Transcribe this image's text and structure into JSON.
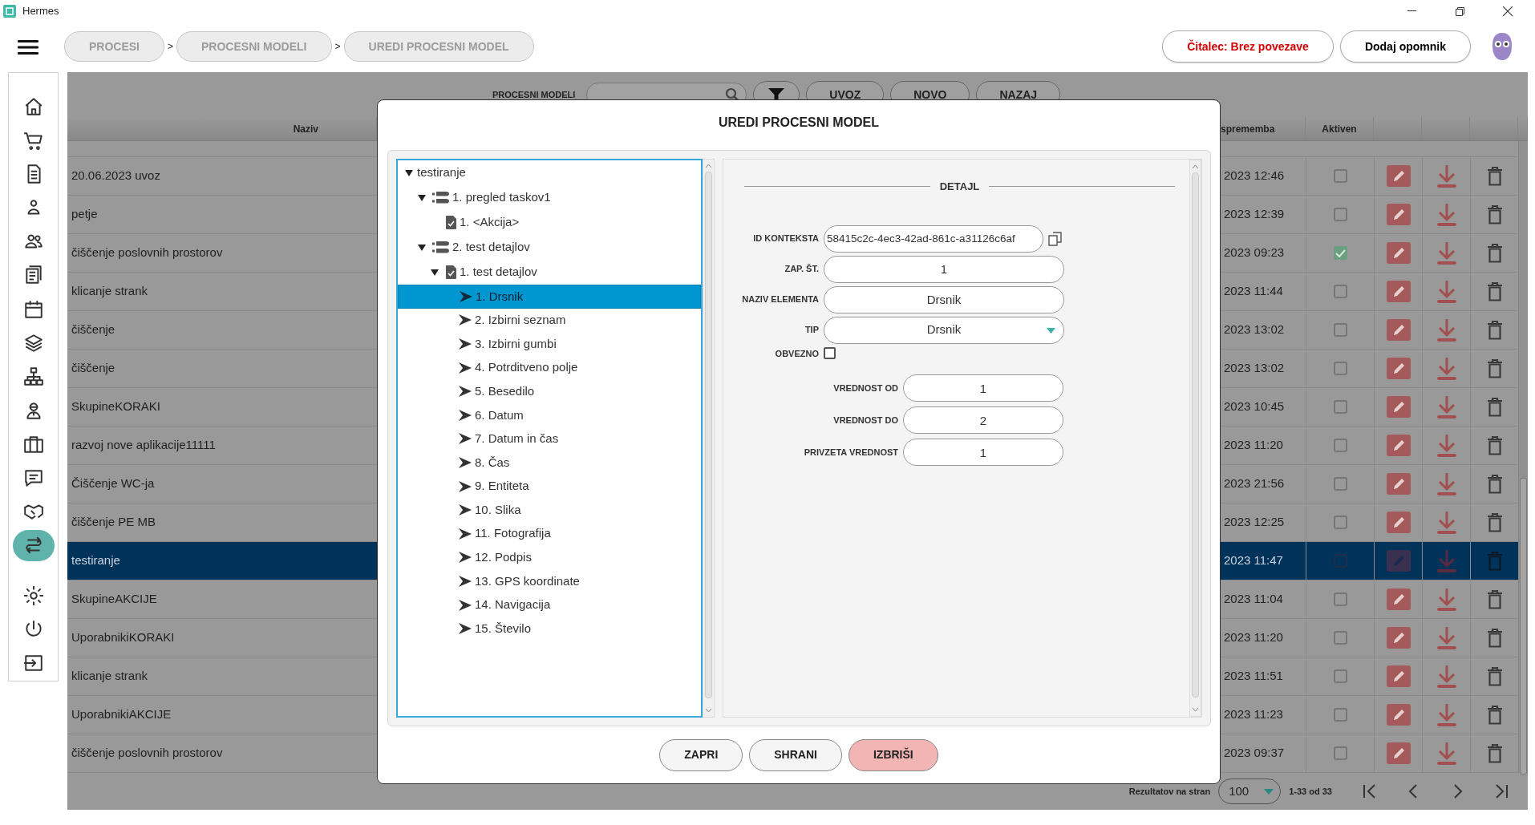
{
  "window": {
    "title": "Hermes"
  },
  "top_bar": {
    "breadcrumbs": [
      {
        "kind": "crumb",
        "label": "PROCESI"
      },
      {
        "kind": "separator",
        "label": ">"
      },
      {
        "kind": "crumb",
        "label": "PROCESNI MODELI"
      },
      {
        "kind": "separator",
        "label": ">"
      },
      {
        "kind": "crumb",
        "label": "UREDI PROCESNI MODEL"
      }
    ],
    "reader_button": "Čitalec: Brez povezave",
    "reminder_button": "Dodaj opomnik"
  },
  "sidebar": {
    "items": [
      {
        "selected": false
      },
      {
        "selected": false
      },
      {
        "selected": false
      },
      {
        "selected": false
      },
      {
        "selected": false
      },
      {
        "selected": false
      },
      {
        "selected": false
      },
      {
        "selected": false
      },
      {
        "selected": false
      },
      {
        "selected": false
      },
      {
        "selected": false
      },
      {
        "selected": false
      },
      {
        "selected": false
      },
      {
        "selected": true
      },
      {
        "selected": false
      },
      {
        "selected": false
      },
      {
        "selected": false
      }
    ]
  },
  "toolbar": {
    "label": "PROCESNI MODELI",
    "buttons": [
      "UVOZ",
      "NOVO",
      "NAZAJ"
    ]
  },
  "table": {
    "columns": [
      "Naziv",
      "sprememba",
      "Aktiven"
    ],
    "rows": [
      {
        "name": "20.06.2023 uvoz",
        "modified": "2023 12:46",
        "active": false,
        "selected": false
      },
      {
        "name": "petje",
        "modified": "2023 12:39",
        "active": false,
        "selected": false
      },
      {
        "name": "čiščenje poslovnih prostorov",
        "modified": "2023 09:23",
        "active": true,
        "selected": false
      },
      {
        "name": "klicanje strank",
        "modified": "2023 11:44",
        "active": false,
        "selected": false
      },
      {
        "name": "čiščenje",
        "modified": "2023 13:02",
        "active": false,
        "selected": false
      },
      {
        "name": "čiščenje",
        "modified": "2023 13:02",
        "active": false,
        "selected": false
      },
      {
        "name": "SkupineKORAKI",
        "modified": "2023 10:45",
        "active": false,
        "selected": false
      },
      {
        "name": "razvoj nove aplikacije11111",
        "modified": "2023 11:20",
        "active": false,
        "selected": false
      },
      {
        "name": "Čiščenje WC-ja",
        "modified": "2023 21:56",
        "active": false,
        "selected": false
      },
      {
        "name": "čiščenje PE MB",
        "modified": "2023 12:25",
        "active": false,
        "selected": false
      },
      {
        "name": "testiranje",
        "modified": "2023 11:47",
        "active": false,
        "selected": true
      },
      {
        "name": "SkupineAKCIJE",
        "modified": "2023 11:04",
        "active": false,
        "selected": false
      },
      {
        "name": "UporabnikiKORAKI",
        "modified": "2023 11:20",
        "active": false,
        "selected": false
      },
      {
        "name": "klicanje strank",
        "modified": "2023 11:51",
        "active": false,
        "selected": false
      },
      {
        "name": "UporabnikiAKCIJE",
        "modified": "2023 11:23",
        "active": false,
        "selected": false
      },
      {
        "name": "čiščenje poslovnih prostorov",
        "modified": "2023 09:37",
        "active": false,
        "selected": false
      }
    ]
  },
  "pagination": {
    "label": "Rezultatov na stran",
    "page_size": "100",
    "range": "1-33 od 33"
  },
  "dialog": {
    "title": "UREDI PROCESNI MODEL",
    "tree": [
      {
        "kind": "root",
        "label": "testiranje",
        "expanded": true,
        "selected": false,
        "children": [
          {
            "kind": "step",
            "label": "1. pregled taskov1",
            "expanded": true,
            "selected": false,
            "children": [
              {
                "kind": "action",
                "label": "1. <Akcija>",
                "selected": false
              }
            ]
          },
          {
            "kind": "step",
            "label": "2. test detajlov",
            "expanded": true,
            "selected": false,
            "children": [
              {
                "kind": "action",
                "label": "1. test detajlov",
                "expanded": true,
                "selected": false,
                "children": [
                  {
                    "kind": "element",
                    "label": "1. Drsnik",
                    "selected": true
                  },
                  {
                    "kind": "element",
                    "label": "2. Izbirni seznam",
                    "selected": false
                  },
                  {
                    "kind": "element",
                    "label": "3. Izbirni gumbi",
                    "selected": false
                  },
                  {
                    "kind": "element",
                    "label": "4. Potrditveno polje",
                    "selected": false
                  },
                  {
                    "kind": "element",
                    "label": "5. Besedilo",
                    "selected": false
                  },
                  {
                    "kind": "element",
                    "label": "6. Datum",
                    "selected": false
                  },
                  {
                    "kind": "element",
                    "label": "7. Datum in čas",
                    "selected": false
                  },
                  {
                    "kind": "element",
                    "label": "8. Čas",
                    "selected": false
                  },
                  {
                    "kind": "element",
                    "label": "9. Entiteta",
                    "selected": false
                  },
                  {
                    "kind": "element",
                    "label": "10. Slika",
                    "selected": false
                  },
                  {
                    "kind": "element",
                    "label": "11. Fotografija",
                    "selected": false
                  },
                  {
                    "kind": "element",
                    "label": "12. Podpis",
                    "selected": false
                  },
                  {
                    "kind": "element",
                    "label": "13. GPS koordinate",
                    "selected": false
                  },
                  {
                    "kind": "element",
                    "label": "14. Navigacija",
                    "selected": false
                  },
                  {
                    "kind": "element",
                    "label": "15. Število",
                    "selected": false
                  }
                ]
              }
            ]
          }
        ]
      }
    ],
    "detail": {
      "heading": "DETAJL",
      "fields": [
        {
          "kind": "copy",
          "label": "ID KONTEKSTA",
          "value": "58415c2c-4ec3-42ad-861c-a31126c6af"
        },
        {
          "kind": "text",
          "label": "ZAP. ŠT.",
          "value": "1"
        },
        {
          "kind": "text",
          "label": "NAZIV ELEMENTA",
          "value": "Drsnik"
        },
        {
          "kind": "select",
          "label": "TIP",
          "value": "Drsnik"
        },
        {
          "kind": "checkbox",
          "label": "OBVEZNO",
          "checked": false
        }
      ],
      "range_fields": [
        {
          "kind": "text",
          "label": "VREDNOST OD",
          "value": "1"
        },
        {
          "kind": "text",
          "label": "VREDNOST DO",
          "value": "2"
        },
        {
          "kind": "text",
          "label": "PRIVZETA VREDNOST",
          "value": "1"
        }
      ]
    },
    "buttons": [
      {
        "kind": "default",
        "label": "ZAPRI"
      },
      {
        "kind": "default",
        "label": "SHRANI"
      },
      {
        "kind": "danger",
        "label": "IZBRIŠI"
      }
    ]
  }
}
